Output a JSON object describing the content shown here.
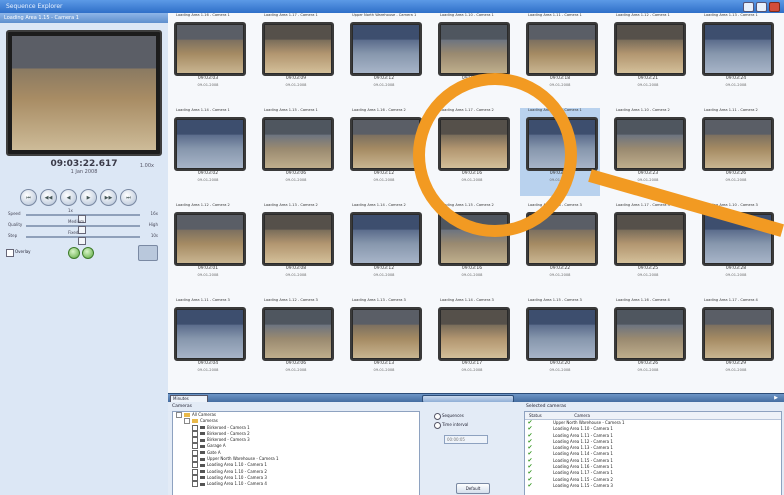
{
  "window": {
    "title": "Sequence Explorer",
    "subtitle": "Loading Area 1.15 - Camera 1"
  },
  "left_panel": {
    "header": "Loading Area 1.15 - Camera 1",
    "time": "09:03:22.617",
    "date": "1 Jan 2008",
    "zoom": "1.00x",
    "controls": [
      "first",
      "prev-frame",
      "rewind",
      "play",
      "next-frame",
      "last"
    ],
    "sliders": [
      {
        "label": "Speed",
        "mid": "1x",
        "right": "16x"
      },
      {
        "label": "Quality",
        "mid": "Medium",
        "right": "High"
      },
      {
        "label": "Step",
        "mid": "Fixed",
        "right": "10s"
      }
    ],
    "checkbox_label": "Overlay"
  },
  "thumbnails": [
    {
      "cap": "Loading Area 1.16 - Camera 1",
      "time": "09:03:03",
      "date": "09-01-2008"
    },
    {
      "cap": "Loading Area 1.17 - Camera 1",
      "time": "09:03:09",
      "date": "09-01-2008"
    },
    {
      "cap": "Upper North Warehouse - Camera 1",
      "time": "09:03:12",
      "date": "09-01-2008"
    },
    {
      "cap": "Loading Area 1.10 - Camera 1",
      "time": "09:03:15",
      "date": "09-01-2008"
    },
    {
      "cap": "Loading Area 1.11 - Camera 1",
      "time": "09:03:18",
      "date": "09-01-2008"
    },
    {
      "cap": "Loading Area 1.12 - Camera 1",
      "time": "09:03:21",
      "date": "09-01-2008"
    },
    {
      "cap": "Loading Area 1.13 - Camera 1",
      "time": "09:03:24",
      "date": "09-01-2008"
    },
    {
      "cap": "Loading Area 1.14 - Camera 1",
      "time": "09:03:02",
      "date": "09-01-2008"
    },
    {
      "cap": "Loading Area 1.15 - Camera 1",
      "time": "09:03:06",
      "date": "09-01-2008"
    },
    {
      "cap": "Loading Area 1.16 - Camera 2",
      "time": "09:03:12",
      "date": "09-01-2008"
    },
    {
      "cap": "Loading Area 1.17 - Camera 2",
      "time": "09:03:16",
      "date": "09-01-2008"
    },
    {
      "cap": "Loading Area 1.15 - Camera 1",
      "time": "09:03:20",
      "date": "09-01-2008"
    },
    {
      "cap": "Loading Area 1.10 - Camera 2",
      "time": "09:03:23",
      "date": "09-01-2008"
    },
    {
      "cap": "Loading Area 1.11 - Camera 2",
      "time": "09:03:26",
      "date": "09-01-2008"
    },
    {
      "cap": "Loading Area 1.12 - Camera 2",
      "time": "09:03:01",
      "date": "09-01-2008"
    },
    {
      "cap": "Loading Area 1.13 - Camera 2",
      "time": "09:03:08",
      "date": "09-01-2008"
    },
    {
      "cap": "Loading Area 1.14 - Camera 2",
      "time": "09:03:12",
      "date": "09-01-2008"
    },
    {
      "cap": "Loading Area 1.15 - Camera 2",
      "time": "09:03:16",
      "date": "09-01-2008"
    },
    {
      "cap": "Loading Area 1.16 - Camera 3",
      "time": "09:03:22",
      "date": "09-01-2008"
    },
    {
      "cap": "Loading Area 1.17 - Camera 3",
      "time": "09:03:25",
      "date": "09-01-2008"
    },
    {
      "cap": "Loading Area 1.10 - Camera 3",
      "time": "09:03:28",
      "date": "09-01-2008"
    },
    {
      "cap": "Loading Area 1.11 - Camera 3",
      "time": "09:03:04",
      "date": "09-01-2008"
    },
    {
      "cap": "Loading Area 1.12 - Camera 3",
      "time": "09:03:06",
      "date": "09-01-2008"
    },
    {
      "cap": "Loading Area 1.13 - Camera 3",
      "time": "09:03:13",
      "date": "09-01-2008"
    },
    {
      "cap": "Loading Area 1.14 - Camera 3",
      "time": "09:03:17",
      "date": "09-01-2008"
    },
    {
      "cap": "Loading Area 1.15 - Camera 3",
      "time": "09:03:20",
      "date": "09-01-2008"
    },
    {
      "cap": "Loading Area 1.16 - Camera 4",
      "time": "09:03:26",
      "date": "09-01-2008"
    },
    {
      "cap": "Loading Area 1.17 - Camera 4",
      "time": "09:03:29",
      "date": "09-01-2008"
    }
  ],
  "selected_index": 11,
  "timeline": {
    "range_label": "Minutes"
  },
  "cameras_panel": {
    "label": "Cameras",
    "items": [
      {
        "text": "All Cameras",
        "kind": "folder",
        "indent": 0
      },
      {
        "text": "Cameras",
        "kind": "folder",
        "indent": 1
      },
      {
        "text": "Birkeroed - Camera 1",
        "kind": "camera",
        "indent": 2
      },
      {
        "text": "Birkeroed - Camera 2",
        "kind": "camera",
        "indent": 2
      },
      {
        "text": "Birkeroed - Camera 3",
        "kind": "camera",
        "indent": 2
      },
      {
        "text": "Garage A",
        "kind": "camera",
        "indent": 2
      },
      {
        "text": "Gate A",
        "kind": "camera",
        "indent": 2
      },
      {
        "text": "Upper North Warehouse - Camera 1",
        "kind": "camera",
        "indent": 2
      },
      {
        "text": "Loading Area 1.10 - Camera 1",
        "kind": "camera",
        "indent": 2
      },
      {
        "text": "Loading Area 1.10 - Camera 2",
        "kind": "camera",
        "indent": 2
      },
      {
        "text": "Loading Area 1.10 - Camera 3",
        "kind": "camera",
        "indent": 2
      },
      {
        "text": "Loading Area 1.10 - Camera 4",
        "kind": "camera",
        "indent": 2
      }
    ]
  },
  "options": {
    "radio_1": "Sequences",
    "radio_2": "Time interval",
    "interval_value": "00:00:05",
    "default_button": "Default"
  },
  "selected_cameras": {
    "label": "Selected cameras",
    "col_status": "Status",
    "col_camera": "Camera",
    "rows": [
      "Upper North Warehouse - Camera 1",
      "Loading Area 1.10 - Camera 1",
      "Loading Area 1.11 - Camera 1",
      "Loading Area 1.12 - Camera 1",
      "Loading Area 1.13 - Camera 1",
      "Loading Area 1.14 - Camera 1",
      "Loading Area 1.15 - Camera 1",
      "Loading Area 1.16 - Camera 1",
      "Loading Area 1.17 - Camera 1",
      "Loading Area 1.15 - Camera 2",
      "Loading Area 1.15 - Camera 3"
    ]
  },
  "colors": {
    "accent": "#f29a22",
    "titlebar": "#2f6fc8",
    "selected": "#b9d2ee"
  }
}
